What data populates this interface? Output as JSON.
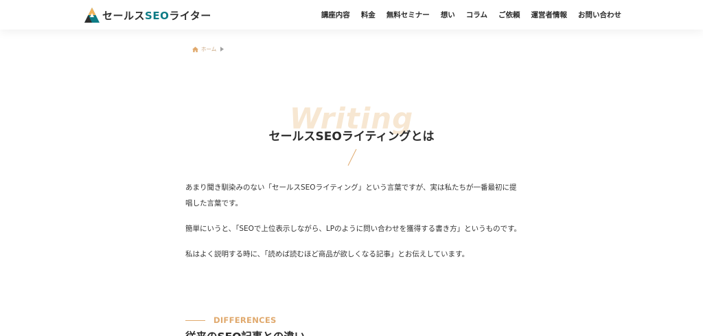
{
  "header": {
    "logo": {
      "text_part1": "セールス",
      "text_accent": "SEO",
      "text_part2": "ライター"
    },
    "nav": [
      "講座内容",
      "料金",
      "無料セミナー",
      "想い",
      "コラム",
      "ご依頼",
      "運営者情報",
      "お問い合わせ"
    ]
  },
  "breadcrumb": {
    "home": "ホーム"
  },
  "section": {
    "bg_word": "Writing",
    "title": "セールスSEOライティングとは",
    "paragraphs": [
      "あまり聞き馴染みのない「セールスSEOライティング」という言葉ですが、実は私たちが一番最初に提唱した言葉です。",
      "簡単にいうと、「SEOで上位表示しながら、LPのように問い合わせを獲得する書き方」というものです。",
      "私はよく説明する時に、「読めば読むほど商品が欲しくなる記事」とお伝えしています。"
    ]
  },
  "subsection": {
    "label": "DIFFERENCES",
    "heading": "従来のSEO記事との違い"
  },
  "colors": {
    "accent": "#e0a96d",
    "logo_teal": "#0e7c86",
    "text": "#333333"
  }
}
